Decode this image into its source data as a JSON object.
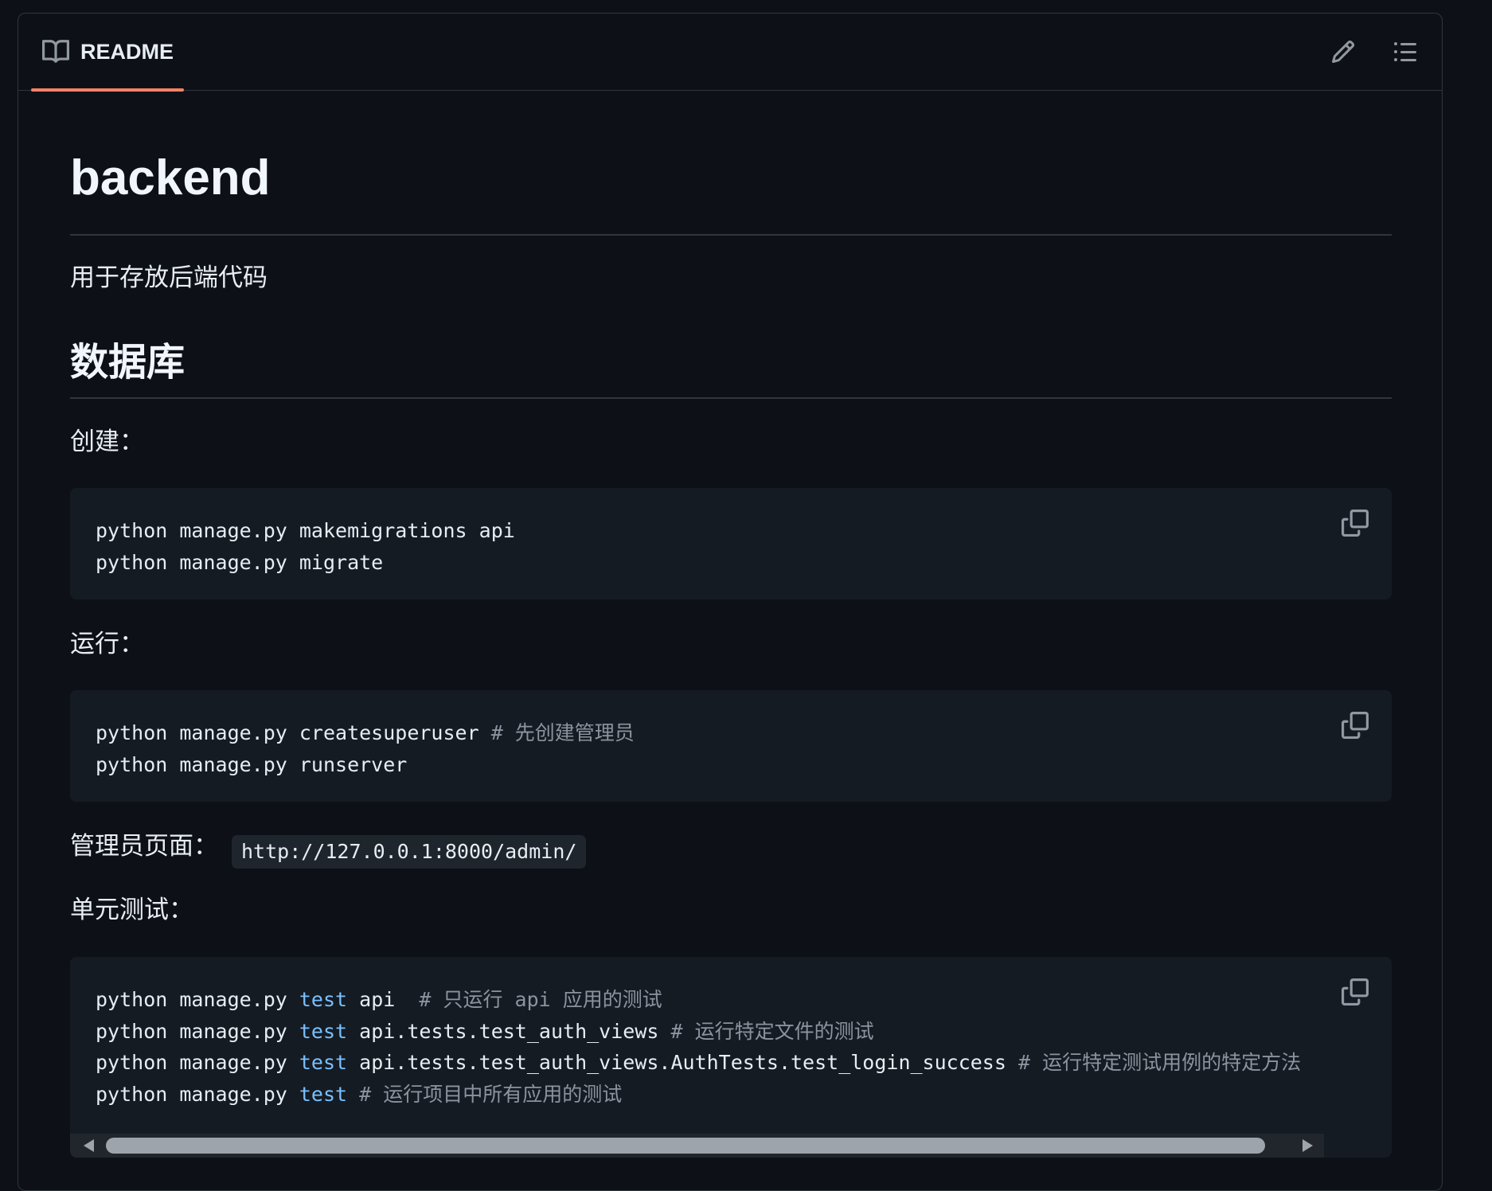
{
  "header": {
    "tab_label": "README",
    "edit_icon": "pencil-icon",
    "toc_icon": "list-unordered-icon",
    "accent_color": "#f78166"
  },
  "readme": {
    "title": "backend",
    "description": "用于存放后端代码",
    "section_heading": "数据库",
    "create_label": "创建：",
    "create_code": [
      "python manage.py makemigrations api",
      "python manage.py migrate"
    ],
    "run_label": "运行：",
    "run_code": [
      {
        "cmd": "python manage.py createsuperuser ",
        "comment": "# 先创建管理员"
      },
      {
        "cmd": "python manage.py runserver",
        "comment": ""
      }
    ],
    "admin_label": "管理员页面：",
    "admin_url": "http://127.0.0.1:8000/admin/",
    "test_label": "单元测试：",
    "test_code": [
      {
        "pre": "python manage.py ",
        "kw": "test",
        "post": " api  ",
        "comment": "# 只运行 api 应用的测试"
      },
      {
        "pre": "python manage.py ",
        "kw": "test",
        "post": " api.tests.test_auth_views ",
        "comment": "# 运行特定文件的测试"
      },
      {
        "pre": "python manage.py ",
        "kw": "test",
        "post": " api.tests.test_auth_views.AuthTests.test_login_success ",
        "comment": "# 运行特定测试用例的特定方法"
      },
      {
        "pre": "python manage.py ",
        "kw": "test",
        "post": " ",
        "comment": "# 运行项目中所有应用的测试"
      }
    ],
    "copy_icon": "copy-icon"
  }
}
